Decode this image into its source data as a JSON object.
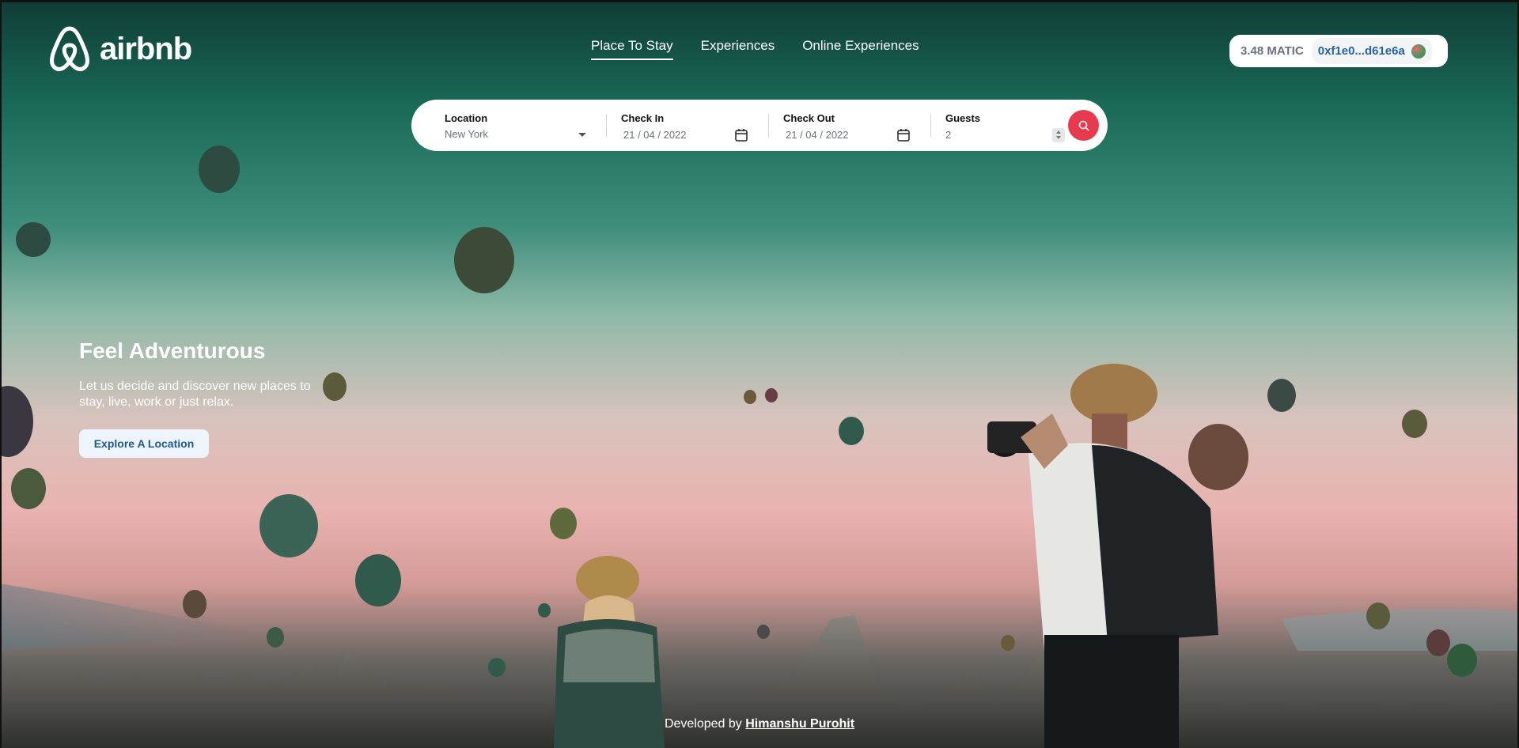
{
  "brand": {
    "logo_text": "airbnb"
  },
  "nav": {
    "items": [
      {
        "label": "Place To Stay",
        "active": true
      },
      {
        "label": "Experiences",
        "active": false
      },
      {
        "label": "Online Experiences",
        "active": false
      }
    ]
  },
  "wallet": {
    "balance": "3.48 MATIC",
    "address": "0xf1e0...d61e6a"
  },
  "search": {
    "location": {
      "label": "Location",
      "value": "New York"
    },
    "check_in": {
      "label": "Check In",
      "value": "21 / 04 / 2022"
    },
    "check_out": {
      "label": "Check Out",
      "value": "21 / 04 / 2022"
    },
    "guests": {
      "label": "Guests",
      "value": "2"
    }
  },
  "hero": {
    "title": "Feel Adventurous",
    "subtitle": "Let us decide and discover new places to stay, live, work or just relax.",
    "cta_label": "Explore A Location"
  },
  "footer": {
    "prefix": "Developed by",
    "author": "Himanshu Purohit"
  },
  "colors": {
    "accent": "#e8394f",
    "link": "#2563a8",
    "cta_text": "#1e5c8a"
  }
}
